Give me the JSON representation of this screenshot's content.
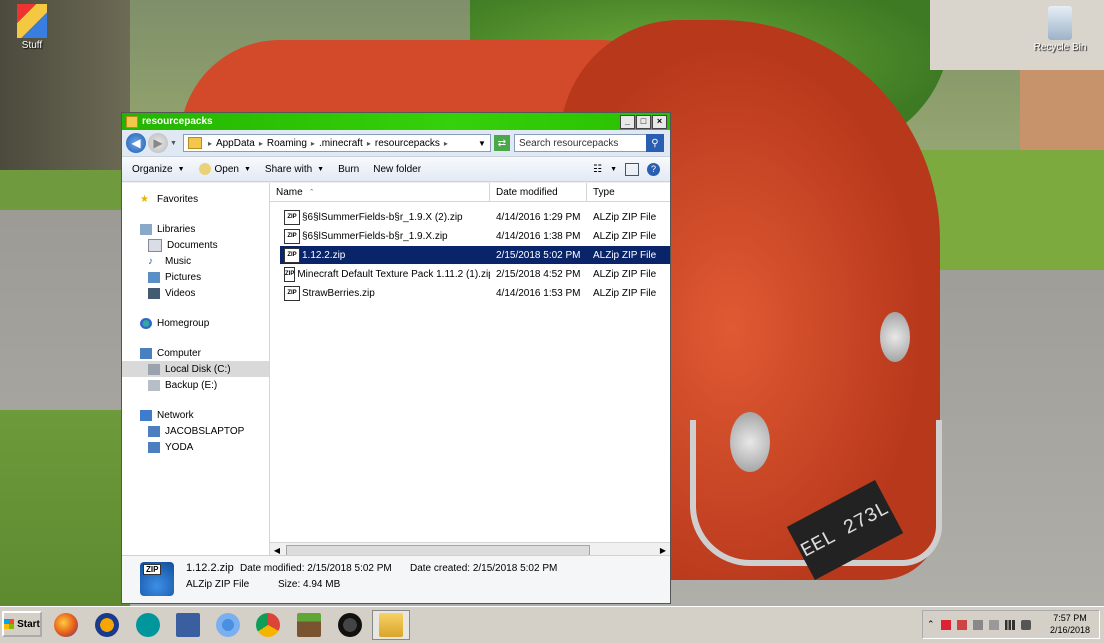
{
  "desktop": {
    "icons": [
      {
        "label": "Stuff"
      },
      {
        "label": "Recycle Bin"
      }
    ],
    "wallpaper_plate": "EEL 273L"
  },
  "window": {
    "title": "resourcepacks",
    "address": {
      "segments": [
        "AppData",
        "Roaming",
        ".minecraft",
        "resourcepacks"
      ]
    },
    "search_placeholder": "Search resourcepacks",
    "toolbar": {
      "organize": "Organize",
      "open": "Open",
      "share_with": "Share with",
      "burn": "Burn",
      "new_folder": "New folder"
    },
    "nav": {
      "favorites": "Favorites",
      "libraries": "Libraries",
      "documents": "Documents",
      "music": "Music",
      "pictures": "Pictures",
      "videos": "Videos",
      "homegroup": "Homegroup",
      "computer": "Computer",
      "local_disk": "Local Disk (C:)",
      "backup": "Backup (E:)",
      "network": "Network",
      "net1": "JACOBSLAPTOP",
      "net2": "YODA"
    },
    "columns": {
      "name": "Name",
      "date": "Date modified",
      "type": "Type"
    },
    "files": [
      {
        "name": "§6§lSummerFields-b§r_1.9.X (2).zip",
        "date": "4/14/2016 1:29 PM",
        "type": "ALZip ZIP File",
        "selected": false
      },
      {
        "name": "§6§lSummerFields-b§r_1.9.X.zip",
        "date": "4/14/2016 1:38 PM",
        "type": "ALZip ZIP File",
        "selected": false
      },
      {
        "name": "1.12.2.zip",
        "date": "2/15/2018 5:02 PM",
        "type": "ALZip ZIP File",
        "selected": true
      },
      {
        "name": "Minecraft Default Texture Pack 1.11.2 (1).zip",
        "date": "2/15/2018 4:52 PM",
        "type": "ALZip ZIP File",
        "selected": false
      },
      {
        "name": "StrawBerries.zip",
        "date": "4/14/2016 1:53 PM",
        "type": "ALZip ZIP File",
        "selected": false
      }
    ],
    "details": {
      "icon_text": "ZIP",
      "filename": "1.12.2.zip",
      "filetype": "ALZip ZIP File",
      "modified": "Date modified:  2/15/2018 5:02 PM",
      "size": "Size:  4.94 MB",
      "created": "Date created:  2/15/2018 5:02 PM"
    }
  },
  "taskbar": {
    "start": "Start",
    "time": "7:57 PM",
    "date": "2/16/2018"
  }
}
